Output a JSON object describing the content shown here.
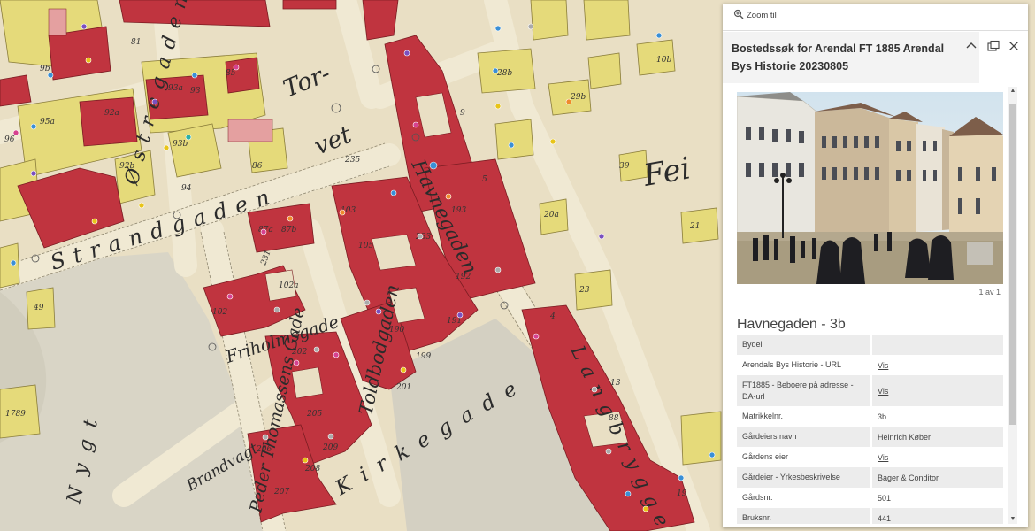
{
  "map": {
    "streets": [
      "Torvet",
      "Strandgaden",
      "Havnegaden",
      "Friholmsgade",
      "Toldbodgaden",
      "Peder Thomassens Gade",
      "Brandvagt",
      "Kirkegade",
      "Langbrygge",
      "Østregaden",
      "Nygt"
    ],
    "plot_numbers": [
      "81",
      "93a",
      "93",
      "92a",
      "92b",
      "93b",
      "94",
      "85",
      "87a",
      "87b",
      "102a",
      "102",
      "103",
      "105",
      "190",
      "191",
      "192",
      "193",
      "199",
      "201",
      "202",
      "206",
      "207",
      "208",
      "209",
      "205",
      "9",
      "5",
      "4",
      "88",
      "19",
      "13",
      "28b",
      "29b",
      "39",
      "20a",
      "23",
      "21",
      "10b",
      "1789",
      "49"
    ],
    "zone_numbers": [
      "235",
      "233",
      "231"
    ]
  },
  "popup": {
    "zoom_label": "Zoom til",
    "title": "Bostedssøk for Arendal FT 1885 Arendal Bys Historie 20230805",
    "pager": "1 av 1",
    "feature_title": "Havnegaden - 3b",
    "attributes": [
      {
        "key": "Bydel",
        "value": "",
        "link": false
      },
      {
        "key": "Arendals Bys Historie - URL",
        "value": "Vis",
        "link": true
      },
      {
        "key": "FT1885 - Beboere på adresse - DA-url",
        "value": "Vis",
        "link": true
      },
      {
        "key": "Matrikkelnr.",
        "value": "3b",
        "link": false
      },
      {
        "key": "Gårdeiers navn",
        "value": "Heinrich Køber",
        "link": false
      },
      {
        "key": "Gårdens eier",
        "value": "Vis",
        "link": true
      },
      {
        "key": "Gårdeier - Yrkesbeskrivelse",
        "value": "Bager & Conditor",
        "link": false
      },
      {
        "key": "Gårdsnr.",
        "value": "501",
        "link": false
      },
      {
        "key": "Bruksnr.",
        "value": "441",
        "link": false
      }
    ]
  },
  "colors": {
    "parchment": "#e9dfc4",
    "block_red": "#c0343f",
    "block_yellow": "#e5da7a",
    "road": "#d8cfb4"
  }
}
